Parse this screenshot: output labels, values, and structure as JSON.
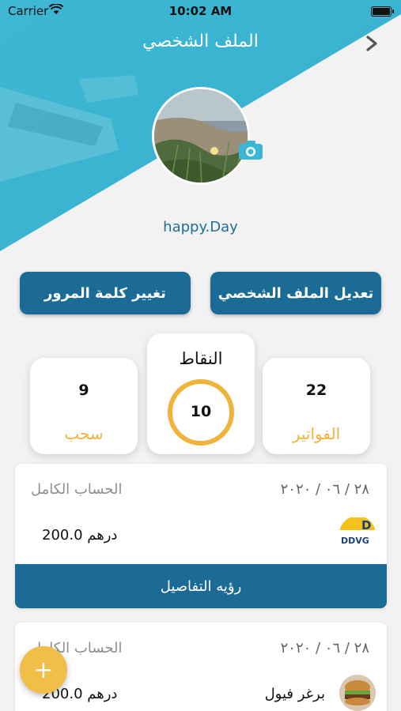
{
  "status_bar": {
    "carrier": "Carrier",
    "time": "10:02 AM"
  },
  "header": {
    "title": "الملف الشخصي"
  },
  "profile": {
    "username": "happy.Day"
  },
  "buttons": {
    "change_password": "تغيير كلمة المرور",
    "edit_profile": "تعديل الملف الشخصي"
  },
  "stats": {
    "withdraw": {
      "value": "9",
      "label": "سحب"
    },
    "points": {
      "title": "النقاط",
      "value": "10"
    },
    "invoices": {
      "value": "22",
      "label": "الفواتير"
    }
  },
  "transactions": [
    {
      "date": "٢٨ / ٠٦ / ٢٠٢٠",
      "type": "الحساب الكامل",
      "amount": "200.0 درهم",
      "merchant": "",
      "logo_text": "D",
      "logo_sub": "DDVG",
      "details_label": "رؤيه التفاصيل"
    },
    {
      "date": "٢٨ / ٠٦ / ٢٠٢٠",
      "type": "الحساب الكامل",
      "amount": "200.0 درهم",
      "merchant": "برغر فيول"
    }
  ],
  "fab": {
    "label": "+"
  },
  "colors": {
    "primary": "#1c6b96",
    "accent": "#f0b43a",
    "header": "#3fb8d2"
  }
}
